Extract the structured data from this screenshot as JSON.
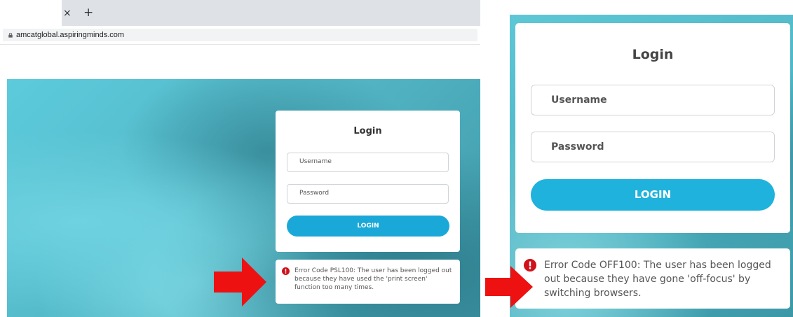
{
  "left": {
    "tab": {
      "close_label": "×",
      "new_tab_label": "+"
    },
    "address": {
      "url": "amcatglobal.aspiringminds.com"
    },
    "login": {
      "title": "Login",
      "username_placeholder": "Username",
      "password_placeholder": "Password",
      "button_label": "LOGIN"
    },
    "error": {
      "message": "Error Code PSL100: The user has been logged out because they have used the 'print screen' function too many times."
    }
  },
  "right": {
    "login": {
      "title": "Login",
      "username_placeholder": "Username",
      "password_placeholder": "Password",
      "button_label": "LOGIN"
    },
    "error": {
      "message": "Error Code OFF100: The user has been logged out because they have gone 'off-focus' by switching browsers."
    }
  },
  "colors": {
    "accent": "#1aa8d8",
    "error_icon": "#d0121b",
    "arrow": "#ee1111"
  }
}
